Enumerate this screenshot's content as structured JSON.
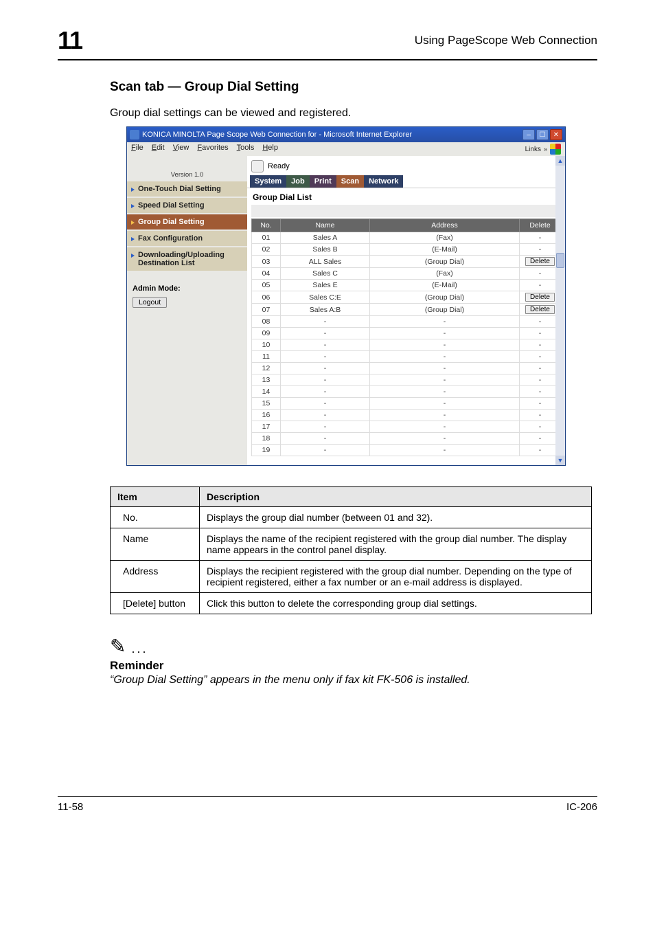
{
  "chapter_number": "11",
  "page_title": "Using PageScope Web Connection",
  "section_heading": "Scan tab — Group Dial Setting",
  "section_intro": "Group dial settings can be viewed and registered.",
  "browser": {
    "title": "KONICA MINOLTA Page Scope Web Connection for        - Microsoft Internet Explorer",
    "menu": {
      "file": "File",
      "edit": "Edit",
      "view": "View",
      "favorites": "Favorites",
      "tools": "Tools",
      "help": "Help"
    },
    "links": "Links",
    "ready": "Ready",
    "version": "Version 1.0",
    "tabs": {
      "system": "System",
      "job": "Job",
      "print": "Print",
      "scan": "Scan",
      "network": "Network"
    },
    "sidebar": {
      "items": [
        "One-Touch Dial Setting",
        "Speed Dial Setting",
        "Group Dial Setting",
        "Fax Configuration",
        "Downloading/Uploading Destination List"
      ],
      "admin_label": "Admin Mode:",
      "logout": "Logout"
    },
    "pane_title": "Group Dial List",
    "columns": {
      "no": "No.",
      "name": "Name",
      "address": "Address",
      "delete": "Delete"
    },
    "delete_label": "Delete",
    "rows": [
      {
        "no": "01",
        "name": "Sales A",
        "address": "(Fax)",
        "del": false
      },
      {
        "no": "02",
        "name": "Sales B",
        "address": "(E-Mail)",
        "del": false
      },
      {
        "no": "03",
        "name": "ALL Sales",
        "address": "(Group Dial)",
        "del": true
      },
      {
        "no": "04",
        "name": "Sales C",
        "address": "(Fax)",
        "del": false
      },
      {
        "no": "05",
        "name": "Sales E",
        "address": "(E-Mail)",
        "del": false
      },
      {
        "no": "06",
        "name": "Sales C:E",
        "address": "(Group Dial)",
        "del": true
      },
      {
        "no": "07",
        "name": "Sales A:B",
        "address": "(Group Dial)",
        "del": true
      },
      {
        "no": "08",
        "name": "-",
        "address": "-",
        "del": false
      },
      {
        "no": "09",
        "name": "-",
        "address": "-",
        "del": false
      },
      {
        "no": "10",
        "name": "-",
        "address": "-",
        "del": false
      },
      {
        "no": "11",
        "name": "-",
        "address": "-",
        "del": false
      },
      {
        "no": "12",
        "name": "-",
        "address": "-",
        "del": false
      },
      {
        "no": "13",
        "name": "-",
        "address": "-",
        "del": false
      },
      {
        "no": "14",
        "name": "-",
        "address": "-",
        "del": false
      },
      {
        "no": "15",
        "name": "-",
        "address": "-",
        "del": false
      },
      {
        "no": "16",
        "name": "-",
        "address": "-",
        "del": false
      },
      {
        "no": "17",
        "name": "-",
        "address": "-",
        "del": false
      },
      {
        "no": "18",
        "name": "-",
        "address": "-",
        "del": false
      },
      {
        "no": "19",
        "name": "-",
        "address": "-",
        "del": false
      }
    ]
  },
  "desc_table": {
    "hdr_item": "Item",
    "hdr_desc": "Description",
    "rows": [
      {
        "item": "No.",
        "desc": "Displays the group dial number (between 01 and 32)."
      },
      {
        "item": "Name",
        "desc": "Displays the name of the recipient registered with the group dial number. The display name appears in the control panel display."
      },
      {
        "item": "Address",
        "desc": "Displays the recipient registered with the group dial number. Depending on the type of recipient registered, either a fax number or an e-mail address is displayed."
      },
      {
        "item": "[Delete] button",
        "desc": "Click this button to delete the corresponding group dial settings."
      }
    ]
  },
  "note": {
    "head": "Reminder",
    "body": "“Group Dial Setting” appears in the menu only if fax kit FK-506 is installed."
  },
  "footer": {
    "left": "11-58",
    "right": "IC-206"
  }
}
